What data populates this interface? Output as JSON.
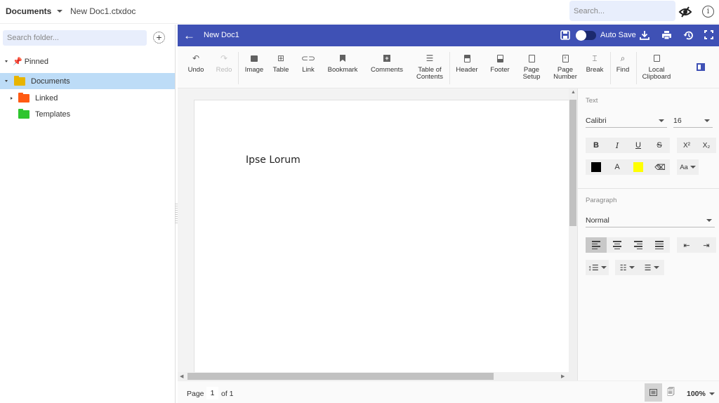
{
  "topbar": {
    "breadcrumb_root": "Documents",
    "file_name": "New Doc1.ctxdoc",
    "search_placeholder": "Search...",
    "eye_icon": "eye-slash-icon",
    "info_icon": "info-icon"
  },
  "sidebar": {
    "search_placeholder": "Search folder...",
    "add_icon": "plus-circle-icon",
    "tree": [
      {
        "label": "Pinned",
        "icon": "pin-icon",
        "expanded": true,
        "selected": false
      },
      {
        "label": "Documents",
        "icon": "folder-open-icon",
        "color": "#e8b400",
        "expanded": true,
        "selected": true
      },
      {
        "label": "Linked",
        "icon": "folder-icon",
        "color": "#ff5a12",
        "expanded": false,
        "selected": false
      },
      {
        "label": "Templates",
        "icon": "folder-icon",
        "color": "#2ec52e",
        "selected": false
      }
    ]
  },
  "editor": {
    "accent": "#3f51b5",
    "title": "New Doc1",
    "autosave_label": "Auto Save",
    "autosave_on": false,
    "toolbar": [
      {
        "label": "Undo",
        "icon": "undo-icon",
        "enabled": true
      },
      {
        "label": "Redo",
        "icon": "redo-icon",
        "enabled": false
      },
      {
        "label": "Image",
        "icon": "image-icon",
        "enabled": true
      },
      {
        "label": "Table",
        "icon": "table-icon",
        "enabled": true
      },
      {
        "label": "Link",
        "icon": "link-icon",
        "enabled": true
      },
      {
        "label": "Bookmark",
        "icon": "bookmark-icon",
        "enabled": true
      },
      {
        "label": "Comments",
        "icon": "comment-add-icon",
        "enabled": true
      },
      {
        "label": "Table of Contents",
        "line1": "Table of",
        "line2": "Contents",
        "icon": "toc-icon",
        "enabled": true
      },
      {
        "label": "Header",
        "icon": "header-icon",
        "enabled": true
      },
      {
        "label": "Footer",
        "icon": "footer-icon",
        "enabled": true
      },
      {
        "label": "Page Setup",
        "line1": "Page",
        "line2": "Setup",
        "icon": "page-setup-icon",
        "enabled": true
      },
      {
        "label": "Page Number",
        "line1": "Page",
        "line2": "Number",
        "icon": "page-number-icon",
        "enabled": true
      },
      {
        "label": "Break",
        "icon": "break-icon",
        "enabled": true
      },
      {
        "label": "Find",
        "icon": "search-icon",
        "enabled": true
      },
      {
        "label": "Local Clipboard",
        "line1": "Local",
        "line2": "Clipboard",
        "icon": "clipboard-icon",
        "enabled": true
      }
    ],
    "document_text": "Ipse Lorum"
  },
  "properties": {
    "text_section": "Text",
    "font_family": "Calibri",
    "font_size": "16",
    "bold": "B",
    "italic": "I",
    "underline": "U",
    "strikethrough": "S",
    "superscript": "X²",
    "subscript": "X₂",
    "font_color": "#000000",
    "font_color_label": "A",
    "highlight_color": "#ffff00",
    "change_case": "Aa",
    "paragraph_section": "Paragraph",
    "paragraph_style": "Normal",
    "alignment_selected": "left"
  },
  "statusbar": {
    "page_label": "Page",
    "current_page": "1",
    "of_label": "of 1",
    "zoom": "100%"
  }
}
